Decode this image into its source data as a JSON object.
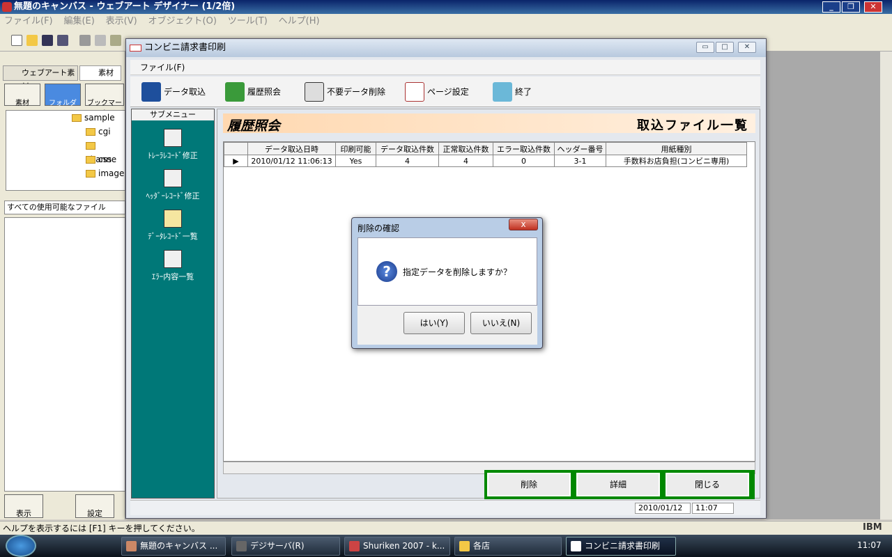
{
  "app": {
    "title": "無題のキャンバス - ウェブアート デザイナー (1/2倍)",
    "menu": [
      "ファイル(F)",
      "編集(E)",
      "表示(V)",
      "オブジェクト(O)",
      "ツール(T)",
      "ヘルプ(H)"
    ],
    "status": "ヘルプを表示するには [F1] キーを押してください。",
    "brand": "IBM"
  },
  "left_panel": {
    "tabs": [
      "ウェブアート素材",
      "素材"
    ],
    "buttons": [
      "素材",
      "フォルダ",
      "ブックマーク"
    ],
    "tree": [
      "sample",
      "cgi",
      "channe",
      "css",
      "image"
    ],
    "file_filter": "すべての使用可能なファイル",
    "bottom_buttons": [
      "表示",
      "設定"
    ]
  },
  "window": {
    "title": "コンビニ請求書印刷",
    "menu_file": "ファイル(F)",
    "toolbar": [
      "データ取込",
      "履歴照会",
      "不要データ削除",
      "ページ設定",
      "終了"
    ],
    "submenu_title": "サブメニュー",
    "submenu": [
      "ﾄﾚｰﾗﾚｺｰﾄﾞ修正",
      "ﾍｯﾀﾞｰﾚｺｰﾄﾞ修正",
      "ﾃﾞｰﾀﾚｺｰﾄﾞ一覧",
      "ｴﾗｰ内容一覧"
    ],
    "heading": "履歴照会",
    "subheading": "取込ファイル一覧",
    "actions": [
      "削除",
      "詳細",
      "閉じる"
    ],
    "status_date": "2010/01/12",
    "status_time": "11:07"
  },
  "table": {
    "columns": [
      "データ取込日時",
      "印刷可能",
      "データ取込件数",
      "正常取込件数",
      "エラー取込件数",
      "ヘッダー番号",
      "用紙種別"
    ],
    "rows": [
      [
        "2010/01/12 11:06:13",
        "Yes",
        "4",
        "4",
        "0",
        "3-1",
        "手数料お店負担(コンビニ専用)"
      ]
    ]
  },
  "dialog": {
    "title": "削除の確認",
    "message": "指定データを削除しますか？",
    "yes": "はい(Y)",
    "no": "いいえ(N)",
    "close": "x"
  },
  "taskbar": {
    "tasks": [
      "無題のキャンバス ...",
      "デジサーバ(R)",
      "Shuriken 2007 - k...",
      "各店",
      "コンビニ請求書印刷"
    ],
    "clock": "11:07"
  }
}
